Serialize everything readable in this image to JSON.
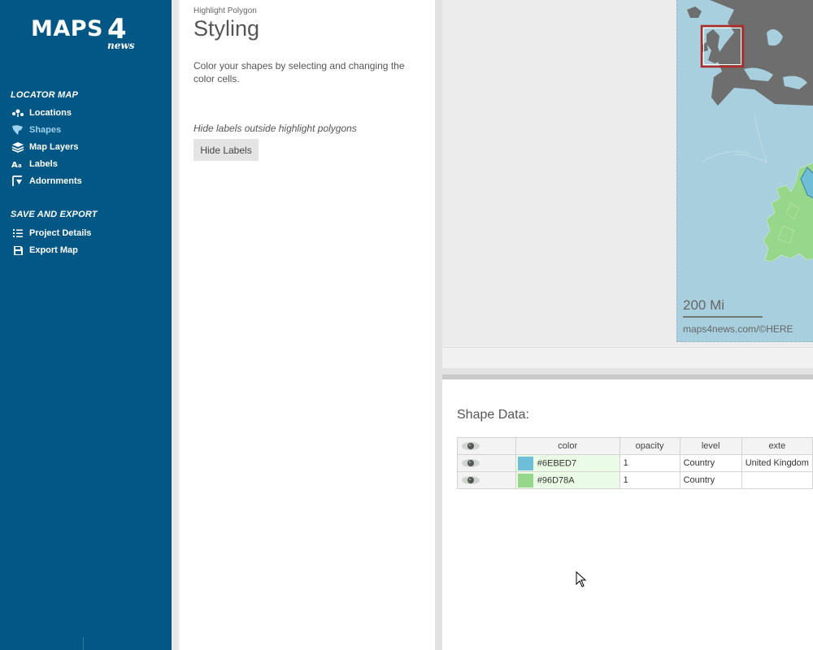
{
  "brand": {
    "logo_main": "MAPS",
    "logo_four": "4",
    "logo_sub": "news"
  },
  "sidebar": {
    "section_locator": "LOCATOR MAP",
    "locator_items": [
      {
        "label": "Locations",
        "icon": "pin-cluster-icon"
      },
      {
        "label": "Shapes",
        "icon": "shape-icon",
        "active": true
      },
      {
        "label": "Map Layers",
        "icon": "layers-icon"
      },
      {
        "label": "Labels",
        "icon": "text-label-icon"
      },
      {
        "label": "Adornments",
        "icon": "adornment-icon"
      }
    ],
    "section_export": "SAVE AND EXPORT",
    "export_items": [
      {
        "label": "Project Details",
        "icon": "list-icon"
      },
      {
        "label": "Export Map",
        "icon": "save-icon"
      }
    ]
  },
  "panel": {
    "subtitle": "Highlight Polygon",
    "title": "Styling",
    "description": "Color your shapes by selecting and changing the color cells.",
    "hide_note": "Hide labels outside highlight polygons",
    "hide_button": "Hide Labels"
  },
  "map": {
    "scale_label": "200 Mi",
    "attribution": "maps4news.com/©HERE",
    "colors": {
      "sea": "#A8CFDD",
      "land": "#6E6E6E",
      "highlight": "#96D78A",
      "inset_frame": "#B02A2A"
    }
  },
  "shape_data": {
    "title": "Shape Data:",
    "columns": [
      "",
      "color",
      "opacity",
      "level",
      "exte"
    ],
    "rows": [
      {
        "color": "#6EBED7",
        "opacity": "1",
        "level": "Country",
        "extra": "United Kingdom"
      },
      {
        "color": "#96D78A",
        "opacity": "1",
        "level": "Country",
        "extra": ""
      }
    ]
  }
}
